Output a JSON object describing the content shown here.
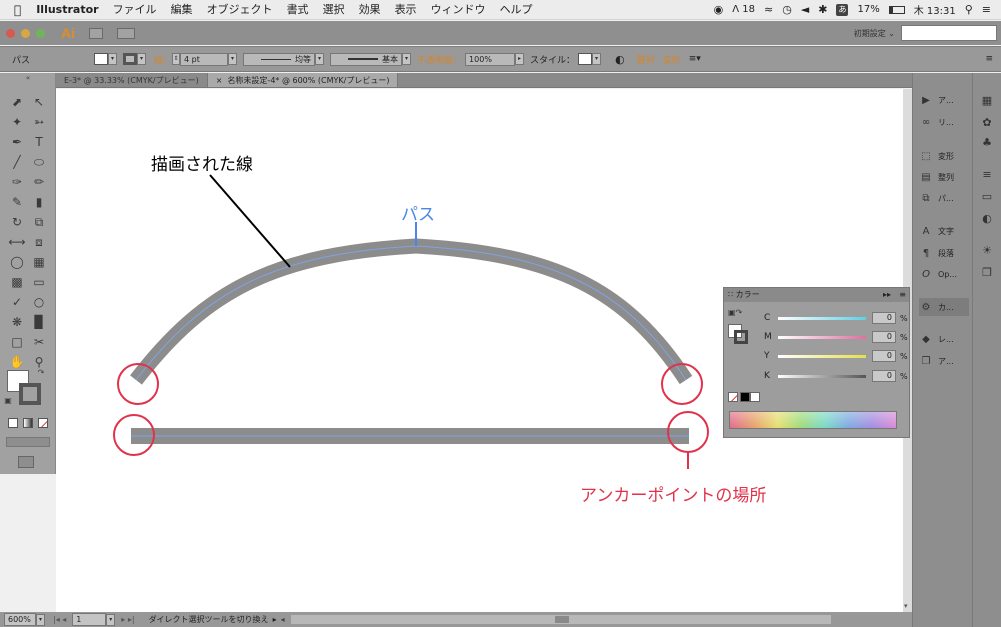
{
  "menubar": {
    "app": "Illustrator",
    "items": [
      "ファイル",
      "編集",
      "オブジェクト",
      "書式",
      "選択",
      "効果",
      "表示",
      "ウィンドウ",
      "ヘルプ"
    ],
    "status": {
      "adobe_count": "18",
      "battery": "17%",
      "clock": "木 13:31",
      "ime": "あ"
    }
  },
  "appbar": {
    "logo": "Ai",
    "workspace": "初期設定 ⌄"
  },
  "controlbar": {
    "object_label": "パス",
    "stroke_label": "線：",
    "stroke_value": "4 pt",
    "uniform_label": "均等",
    "basic_label": "基本",
    "opacity_label": "不透明度：",
    "opacity_value": "100%",
    "style_label": "スタイル：",
    "align_label": "整列",
    "transform_label": "変形"
  },
  "tabs": [
    {
      "label": "E-3* @ 33.33% (CMYK/プレビュー)",
      "active": false
    },
    {
      "label": "名称未設定-4* @ 600% (CMYK/プレビュー)",
      "active": true
    }
  ],
  "bottombar": {
    "zoom": "600%",
    "page": "1",
    "status": "ダイレクト選択ツールを切り換え"
  },
  "dock": {
    "items": [
      {
        "icon": "play-icon",
        "label": "ア..."
      },
      {
        "icon": "link-icon",
        "label": "リ..."
      },
      {
        "icon": "transform-icon",
        "label": "変形"
      },
      {
        "icon": "align-icon",
        "label": "整列"
      },
      {
        "icon": "pathfinder-icon",
        "label": "パ..."
      },
      {
        "icon": "character-icon",
        "label": "文字"
      },
      {
        "icon": "paragraph-icon",
        "label": "段落"
      },
      {
        "icon": "opentype-icon",
        "label": "Op..."
      },
      {
        "icon": "color-icon",
        "label": "カ..."
      },
      {
        "icon": "layers-icon",
        "label": "レ..."
      },
      {
        "icon": "artboards-icon",
        "label": "ア..."
      }
    ]
  },
  "color_panel": {
    "title": "カラー",
    "channels": [
      {
        "name": "C",
        "value": "0",
        "color": "#5fd0e6"
      },
      {
        "name": "M",
        "value": "0",
        "color": "#e06fa0"
      },
      {
        "name": "Y",
        "value": "0",
        "color": "#e6df4a"
      },
      {
        "name": "K",
        "value": "0",
        "color": "#555555"
      }
    ],
    "pct": "%"
  },
  "annotations": {
    "drawn_line": "描画された線",
    "path": "パス",
    "anchor_points": "アンカーポイントの場所"
  },
  "colors": {
    "annotation_red": "#e0334b",
    "annotation_blue": "#4a86e8",
    "stroke_gray": "#8c8c8c",
    "path_blue": "#7fa3e6"
  }
}
